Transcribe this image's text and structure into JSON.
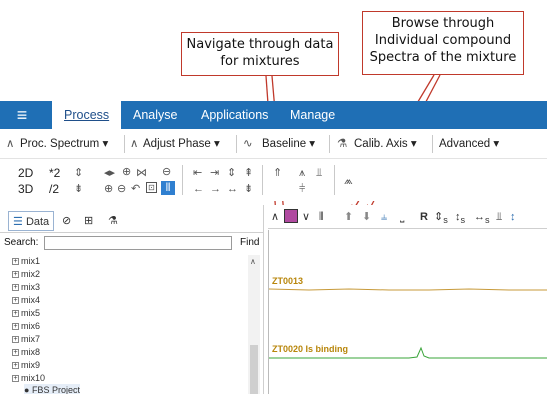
{
  "callouts": {
    "navigate": "Navigate through data for mixtures",
    "browse": "Browse through Individual compound Spectra of the mixture"
  },
  "menubar": {
    "tabs": [
      "Process",
      "Analyse",
      "Applications",
      "Manage"
    ],
    "active": "Process",
    "color": "#1f6fb5"
  },
  "ribbon": {
    "proc_spectrum": "Proc. Spectrum ▾",
    "adjust_phase": "Adjust Phase ▾",
    "baseline": "Baseline ▾",
    "calib_axis": "Calib. Axis ▾",
    "advanced": "Advanced ▾",
    "dim_2d": "2D",
    "dim_3d": "3D",
    "mul2": "*2",
    "div2": "/2"
  },
  "left_panel": {
    "tabs": {
      "data": "Data"
    },
    "search_label": "Search:",
    "find_label": "Find",
    "tree": [
      "mix1",
      "mix2",
      "mix3",
      "mix4",
      "mix5",
      "mix6",
      "mix7",
      "mix8",
      "mix9",
      "mix10",
      "FBS Project"
    ]
  },
  "right_panel": {
    "toolbar": {
      "r": "R",
      "s1": "s",
      "s2": "s",
      "s3": "s"
    },
    "spectra": [
      {
        "label": "ZT0013",
        "color": "#b8860b"
      },
      {
        "label": "ZT0020   Is binding",
        "color": "#b8860b"
      }
    ],
    "trace_colors": [
      "#c79a3a",
      "#3aa43a"
    ]
  }
}
